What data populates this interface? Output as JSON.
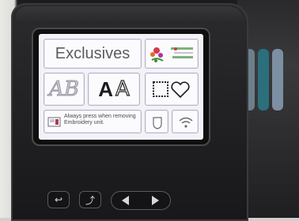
{
  "screen": {
    "exclusives_label": "Exclusives",
    "info_message": "Always press when removing Embroidery unit.",
    "tiles": {
      "designs_icon": "embroidery-designs-icon",
      "fancy_font_icon": "fancy-alphabet-icon",
      "fancy_font_glyphs": "AB",
      "font_glyph_bold": "A",
      "font_glyph_outline": "A",
      "frames_icon": "frame-square-heart-icon",
      "shield_icon": "shield-icon",
      "wifi_icon": "wifi-icon",
      "machine_icon": "machine-icon"
    }
  },
  "hardware": {
    "buttons": [
      {
        "name": "back-button",
        "icon": "back-arrow-icon"
      },
      {
        "name": "needle-button",
        "icon": "needle-position-icon"
      },
      {
        "name": "nav-left-button",
        "icon": "arrow-left-icon"
      },
      {
        "name": "nav-right-button",
        "icon": "arrow-right-icon"
      }
    ]
  },
  "colors": {
    "screen_bg": "#f3f2f7",
    "tile_border": "#b8b4c6",
    "bezel": "#1c1c1e"
  }
}
